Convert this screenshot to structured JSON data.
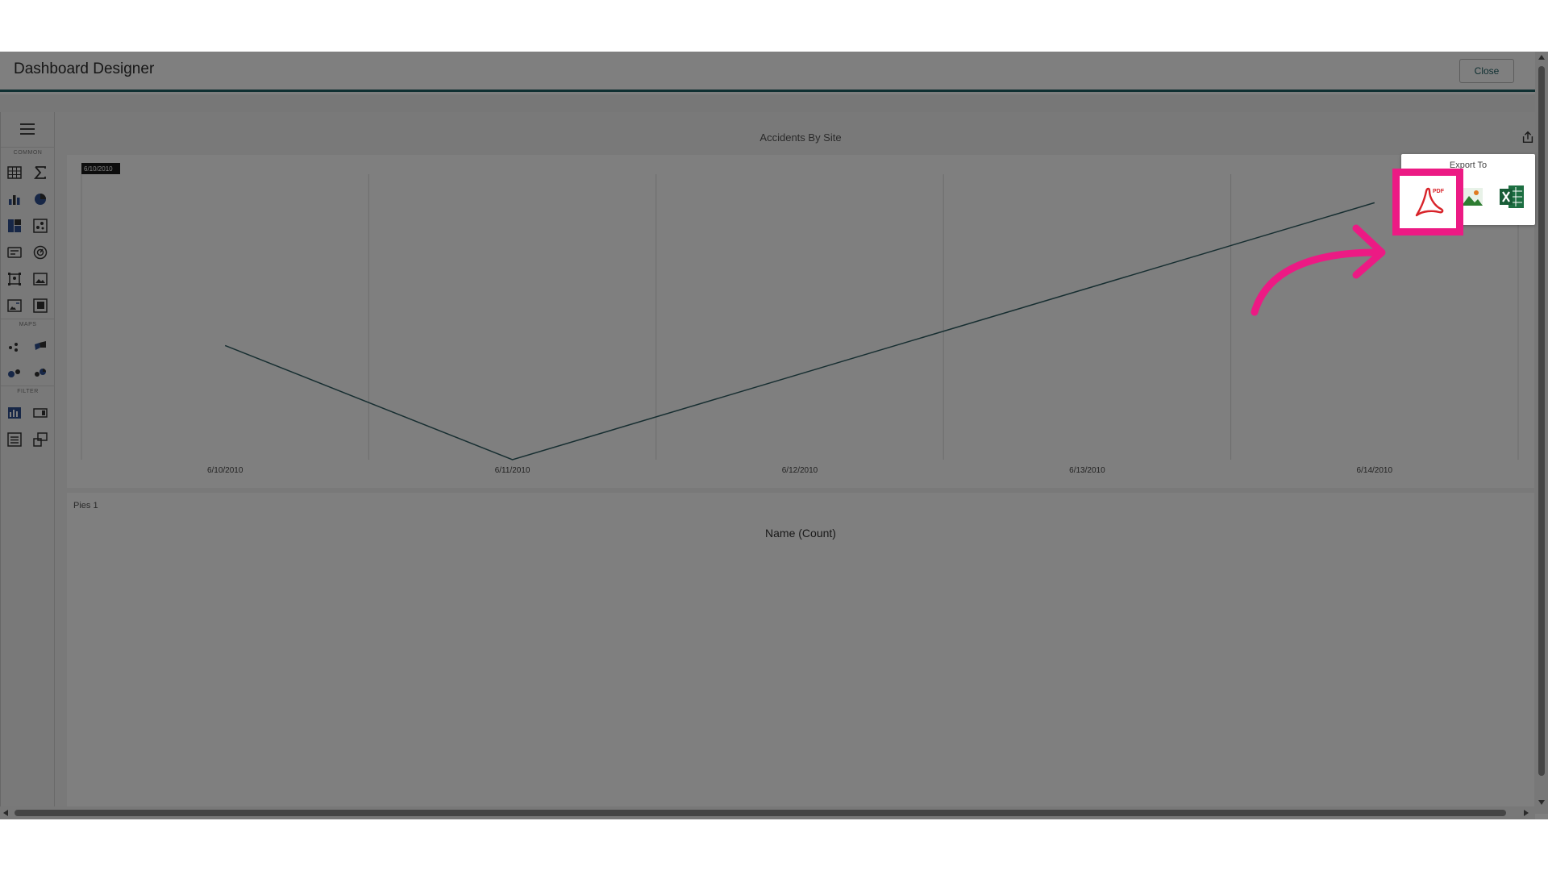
{
  "window": {
    "title": "Dashboard Designer",
    "close_label": "Close"
  },
  "sidebar": {
    "sections": [
      "COMMON",
      "MAPS",
      "FILTER"
    ]
  },
  "panel1": {
    "title": "Accidents By Site"
  },
  "chart_data": {
    "type": "line",
    "title": "Accidents By Site",
    "categories": [
      "6/10/2010",
      "6/11/2010",
      "6/12/2010",
      "6/13/2010",
      "6/14/2010"
    ],
    "values": [
      4,
      0,
      3,
      6,
      9
    ],
    "ylim": [
      0,
      10
    ],
    "grid": true,
    "tooltip": "6/10/2010",
    "line_color": "#2f5d62"
  },
  "panel2": {
    "label": "Pies 1",
    "title": "Name (Count)"
  },
  "export": {
    "label": "Export To",
    "items": [
      {
        "name": "pdf-icon",
        "color": "#d8232a"
      },
      {
        "name": "image-icon",
        "color": "#2e7d32"
      },
      {
        "name": "excel-icon",
        "color": "#1d6f42"
      }
    ]
  },
  "colors": {
    "accent": "#1f5f63",
    "highlight": "#ec1a84"
  }
}
